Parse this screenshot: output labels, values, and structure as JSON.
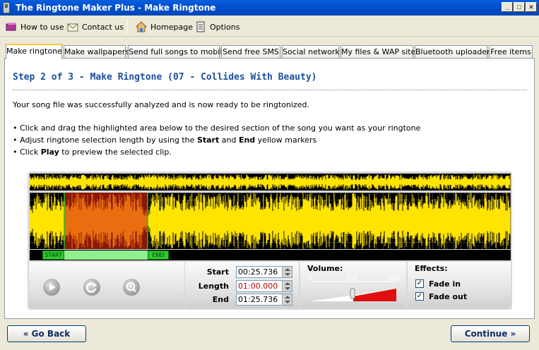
{
  "window": {
    "title": "The Ringtone Maker Plus - Make Ringtone"
  },
  "toolbar": {
    "how_to_use": "How to use",
    "contact_us": "Contact us",
    "homepage": "Homepage",
    "options": "Options"
  },
  "tabs": [
    "Make ringtone",
    "Make wallpapers",
    "Send full songs to mobile",
    "Send free SMS",
    "Social network",
    "My files & WAP site",
    "Bluetooth uploader",
    "Free items"
  ],
  "content": {
    "step_title": "Step 2 of 3 - Make Ringtone (07 - Collides With Beauty)",
    "analyzed_msg": "Your song file was successfully analyzed and is now ready to be ringtonized.",
    "bullet1": "• Click and drag the highlighted area below to the desired section of the song you want as your ringtone",
    "bullet2_a": "• Adjust ringtone selection length by using the ",
    "bullet2_b": "Start",
    "bullet2_c": " and ",
    "bullet2_d": "End",
    "bullet2_e": " yellow markers",
    "bullet3_a": "• Click ",
    "bullet3_b": "Play",
    "bullet3_c": " to preview the selected clip."
  },
  "markers": {
    "start": "START",
    "end": "END"
  },
  "selection": {
    "start_label": "Start",
    "start_value": "00:25.736",
    "length_label": "Length",
    "length_value": "01:00.000",
    "end_label": "End",
    "end_value": "01:25.736"
  },
  "volume": {
    "label": "Volume:",
    "ticks": [
      "0",
      "100",
      "200"
    ],
    "level": 0.5
  },
  "effects": {
    "label": "Effects:",
    "fade_in": "Fade in",
    "fade_out": "Fade out",
    "fade_in_checked": true,
    "fade_out_checked": true
  },
  "nav": {
    "back": "« Go Back",
    "continue": "Continue »"
  },
  "colors": {
    "waveform": "#ffe400",
    "selection": "#e86e10",
    "accent_title": "#1c4f9c"
  }
}
